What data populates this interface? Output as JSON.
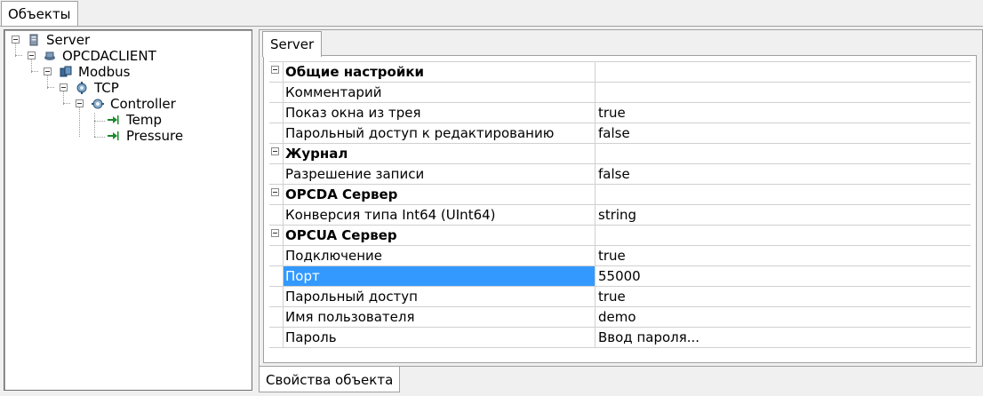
{
  "top_tab": "Объекты",
  "tree": {
    "nodes": [
      {
        "label": "Server",
        "icon": "server-icon"
      },
      {
        "label": "OPCDACLIENT",
        "icon": "opc-client-icon"
      },
      {
        "label": "Modbus",
        "icon": "modbus-icon"
      },
      {
        "label": "TCP",
        "icon": "tcp-icon"
      },
      {
        "label": "Controller",
        "icon": "controller-icon"
      },
      {
        "label": "Temp",
        "icon": "tag-arrow-icon"
      },
      {
        "label": "Pressure",
        "icon": "tag-arrow-icon"
      }
    ]
  },
  "right": {
    "tab": "Server",
    "bottom_tab": "Свойства объекта",
    "properties": [
      {
        "name": "Общие настройки",
        "value": "",
        "category": true
      },
      {
        "name": "Комментарий",
        "value": ""
      },
      {
        "name": "Показ окна из трея",
        "value": "true"
      },
      {
        "name": "Парольный доступ к редактированию",
        "value": "false"
      },
      {
        "name": "Журнал",
        "value": "",
        "category": true
      },
      {
        "name": "Разрешение записи",
        "value": "false"
      },
      {
        "name": "OPCDA Сервер",
        "value": "",
        "category": true
      },
      {
        "name": "Конверсия типа Int64 (UInt64)",
        "value": "string"
      },
      {
        "name": "OPCUA Сервер",
        "value": "",
        "category": true
      },
      {
        "name": "Подключение",
        "value": "true"
      },
      {
        "name": "Порт",
        "value": "55000",
        "selected": true
      },
      {
        "name": "Парольный доступ",
        "value": "true"
      },
      {
        "name": "Имя пользователя",
        "value": "demo"
      },
      {
        "name": "Пароль",
        "value": "Ввод пароля..."
      }
    ]
  },
  "colors": {
    "selection": "#3399ff",
    "icon_green": "#1a8a2a",
    "icon_blue": "#2f6fb0"
  }
}
